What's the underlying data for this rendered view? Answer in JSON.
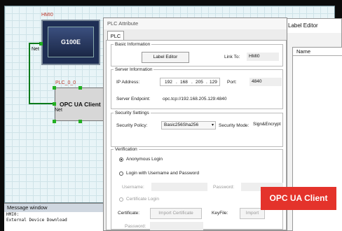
{
  "canvas": {
    "hmi_label": "HMI0",
    "hmi_model": "G100E",
    "net_label_hmi": "Net",
    "plc_label": "PLC_0_0",
    "plc_device": "OPC UA Client",
    "net_label_plc": "Net"
  },
  "message_window": {
    "title": "Message window",
    "lines": [
      "HMI0:",
      "External Device Download"
    ]
  },
  "label_editor": {
    "title": "Label Editor",
    "column_name": "Name"
  },
  "dialog": {
    "title": "PLC Attribute",
    "tab": "PLC",
    "basic": {
      "legend": "Basic Information",
      "label_editor_button": "Label Editor",
      "link_to_label": "Link To:",
      "link_to_value": "HMI0"
    },
    "server": {
      "legend": "Server Information",
      "ip_label": "IP Address:",
      "ip": [
        "192",
        "168",
        "205",
        "129"
      ],
      "port_label": "Port:",
      "port_value": "4840",
      "endpoint_label": "Server Endpoint:",
      "endpoint_value": "opc.tcp://192.168.205.129:4840"
    },
    "security": {
      "legend": "Security Settings",
      "policy_label": "Security Policy:",
      "policy_value": "Basic256Sha256",
      "mode_label": "Security Mode:",
      "mode_value": "Sign&Encrypt"
    },
    "verification": {
      "legend": "Verification",
      "anonymous": "Anonymous Login",
      "user_pass": "Login with Username and Password",
      "username_label": "Username:",
      "password_label": "Password:",
      "certificate_login": "Certificate Login",
      "certificate_label": "Certificate:",
      "import_certificate": "Import Certificate",
      "keyfile_label": "KeyFile:",
      "import_label": "Import",
      "password2_label": "Password:"
    }
  },
  "badge": {
    "text": "OPC UA Client",
    "color": "#e4332b"
  }
}
